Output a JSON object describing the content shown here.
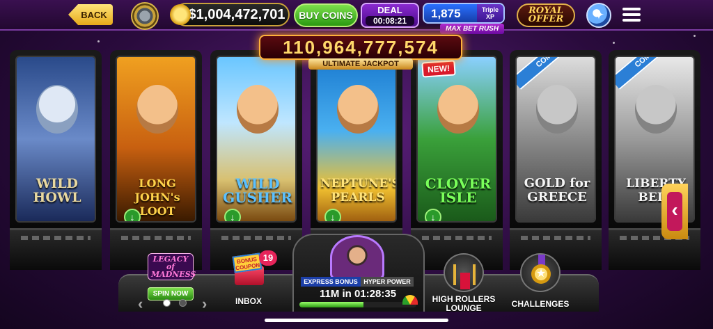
{
  "topbar": {
    "back_label": "BACK",
    "balance": "$1,004,472,701",
    "buy_coins_label": "BUY COINS",
    "deal": {
      "label": "DEAL",
      "countdown": "00:08:21"
    },
    "xp": {
      "value": "1,875",
      "tag": "Triple XP",
      "max_bet_label": "MAX BET RUSH"
    },
    "royal_offer_label": "ROYAL OFFER"
  },
  "jackpot": {
    "amount": "110,964,777,574",
    "label": "ULTIMATE JACKPOT"
  },
  "machines": [
    {
      "title": "WILD HOWL",
      "badge": "",
      "status": "available"
    },
    {
      "title": "LONG JOHN's LOOT",
      "badge": "",
      "status": "download"
    },
    {
      "title": "WILD GUSHER",
      "badge": "",
      "status": "download"
    },
    {
      "title": "NEPTUNE'S PEARLS",
      "badge": "",
      "status": "download"
    },
    {
      "title": "CLOVER ISLE",
      "badge": "NEW!",
      "status": "download"
    },
    {
      "title": "GOLD for GREECE",
      "badge": "COMING SOON",
      "status": "coming-soon"
    },
    {
      "title": "LIBERTY BELL",
      "badge": "COMING SOON",
      "status": "coming-soon"
    }
  ],
  "bottombar": {
    "legacy": {
      "logo": "LEGACY of MADNESS",
      "button": "SPIN NOW"
    },
    "inbox": {
      "label": "INBOX",
      "count": "19",
      "coupon_text": "BONUS COUPON"
    },
    "express": {
      "left_tab": "EXPRESS BONUS",
      "right_tab": "HYPER POWER",
      "timer": "11M in 01:28:35",
      "progress": 0.55
    },
    "lounge_label": "HIGH ROLLERS LOUNGE",
    "challenges_label": "CHALLENGES"
  },
  "colors": {
    "background": "#2a0b3d",
    "gold": "#e6a91a",
    "green": "#2a9a12",
    "purple": "#8a2ad0",
    "xp_blue": "#2a70ff"
  }
}
